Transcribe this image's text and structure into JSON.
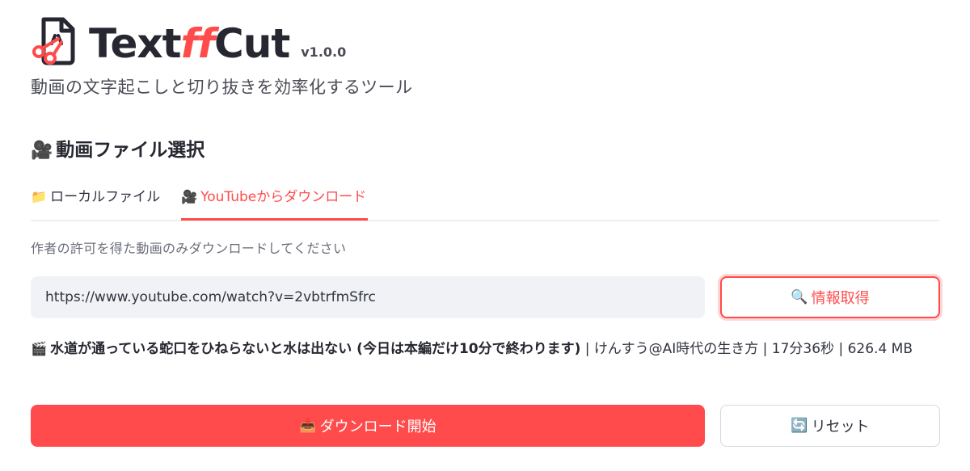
{
  "header": {
    "title_prefix": "Text",
    "title_ff": "ff",
    "title_suffix": "Cut",
    "version": "v1.0.0",
    "subtitle": "動画の文字起こしと切り抜きを効率化するツール"
  },
  "section": {
    "icon": "🎥",
    "title": "動画ファイル選択"
  },
  "tabs": [
    {
      "icon": "📁",
      "label": "ローカルファイル",
      "active": false
    },
    {
      "icon": "🎥",
      "label": "YouTubeからダウンロード",
      "active": true
    }
  ],
  "notice": "作者の許可を得た動画のみダウンロードしてください",
  "url_input": {
    "value": "https://www.youtube.com/watch?v=2vbtrfmSfrc"
  },
  "info_button": {
    "icon": "🔍",
    "label": "情報取得"
  },
  "video_info": {
    "icon": "🎬",
    "title": "水道が通っている蛇口をひねらないと水は出ない (今日は本編だけ10分で終わります)",
    "channel": "けんすう@AI時代の生き方",
    "duration": "17分36秒",
    "size": "626.4 MB"
  },
  "download_button": {
    "icon": "📥",
    "label": "ダウンロード開始"
  },
  "reset_button": {
    "icon": "🔄",
    "label": "リセット"
  },
  "colors": {
    "accent": "#ff4b4b",
    "input_bg": "#f0f2f6",
    "text": "#31333f"
  }
}
